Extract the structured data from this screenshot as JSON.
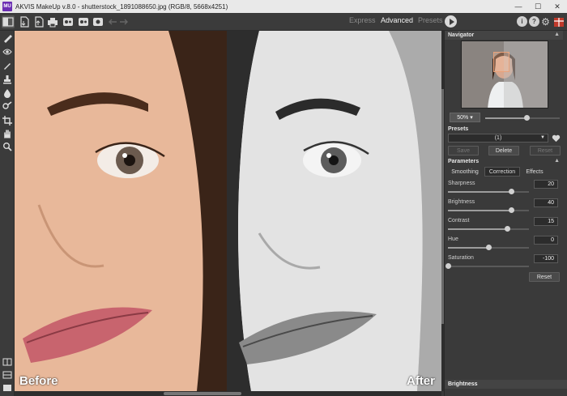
{
  "window": {
    "logo_text": "MU",
    "title": "AKVIS MakeUp v.8.0 - shutterstock_1891088650.jpg (RGB/8, 5668x4251)",
    "controls": [
      "—",
      "☐",
      "✕"
    ]
  },
  "toolbar": {
    "modes": [
      {
        "label": "Express",
        "active": false
      },
      {
        "label": "Advanced",
        "active": true
      },
      {
        "label": "Presets",
        "active": false
      }
    ],
    "icons": [
      "before-after-icon",
      "open-icon",
      "save-icon",
      "print-icon",
      "batch-icon",
      "share-icon",
      "settings-icon",
      "undo-icon",
      "redo-icon"
    ],
    "right_icons": {
      "info": "i",
      "help": "?",
      "settings": "⚙"
    }
  },
  "tools": [
    "smoothing-brush-icon",
    "eye-icon",
    "brush-icon",
    "stamp-icon",
    "drop-icon",
    "chain-brush-icon",
    "crop-icon",
    "hand-icon",
    "zoom-icon"
  ],
  "canvas": {
    "before_label": "Before",
    "after_label": "After"
  },
  "navigator": {
    "title": "Navigator",
    "zoom": "50%",
    "zoom_level": 0.55
  },
  "presets": {
    "title": "Presets",
    "selected": "(1)",
    "save_label": "Save",
    "delete_label": "Delete",
    "reset_label": "Reset"
  },
  "parameters": {
    "title": "Parameters",
    "tabs": [
      {
        "label": "Smoothing",
        "active": false
      },
      {
        "label": "Correction",
        "active": true
      },
      {
        "label": "Effects",
        "active": false
      }
    ],
    "items": [
      {
        "label": "Sharpness",
        "value": "20",
        "level": 0.78
      },
      {
        "label": "Brightness",
        "value": "40",
        "level": 0.78
      },
      {
        "label": "Contrast",
        "value": "15",
        "level": 0.73
      },
      {
        "label": "Hue",
        "value": "0",
        "level": 0.5
      },
      {
        "label": "Saturation",
        "value": "-100",
        "level": 0.0
      }
    ],
    "reset_label": "Reset"
  },
  "hint": {
    "title": "Brightness"
  },
  "colors": {
    "accent": "#6b2fb3",
    "panel": "#3a3a3a",
    "toolbar": "#3b3b3b"
  }
}
